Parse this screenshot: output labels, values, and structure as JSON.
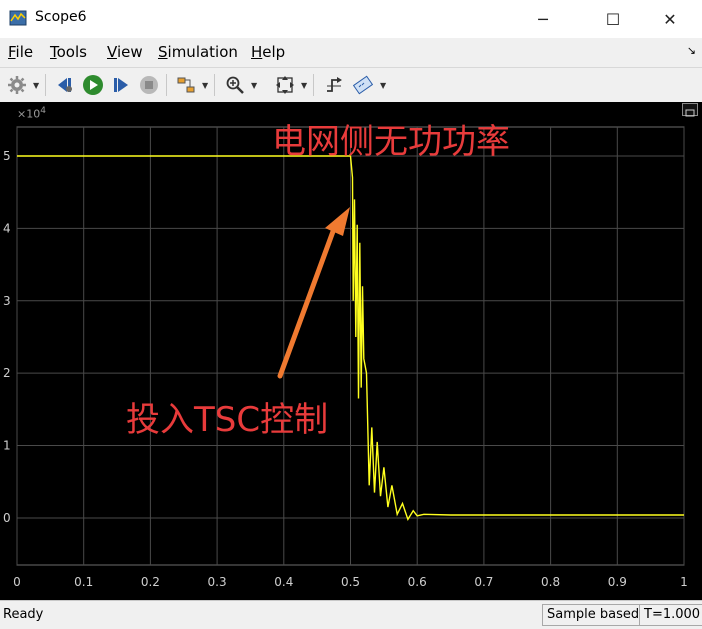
{
  "window": {
    "title": "Scope6",
    "minimize_glyph": "─",
    "maximize_glyph": "☐",
    "close_glyph": "✕"
  },
  "menu": {
    "items": [
      {
        "label": "File",
        "mnemonic": "F",
        "rest": "ile"
      },
      {
        "label": "Tools",
        "mnemonic": "T",
        "rest": "ools"
      },
      {
        "label": "View",
        "mnemonic": "V",
        "rest": "iew"
      },
      {
        "label": "Simulation",
        "mnemonic": "S",
        "rest": "imulation"
      },
      {
        "label": "Help",
        "mnemonic": "H",
        "rest": "elp"
      }
    ],
    "dock_glyph": "↘"
  },
  "toolbar": {
    "icons": [
      "settings-icon",
      "step-back-icon",
      "run-icon",
      "step-forward-icon",
      "stop-icon",
      "highlight-block-icon",
      "zoom-icon",
      "autoscale-icon",
      "triggers-icon",
      "cursor-measurements-icon"
    ]
  },
  "plot": {
    "exponent_label": "×10",
    "exponent_power": "4",
    "annotation_top": "电网侧无功功率",
    "annotation_bottom": "投入TSC控制",
    "annotation_color": "#e83b3b",
    "arrow_color": "#f07a30",
    "background": "#000000",
    "line_color": "#ffff1f"
  },
  "chart_data": {
    "type": "line",
    "title": "",
    "xlabel": "",
    "ylabel": "",
    "xlim": [
      0,
      1
    ],
    "ylim": [
      -0.65,
      5.4
    ],
    "y_scale_exponent": 4,
    "x_ticks": [
      "0",
      "0.1",
      "0.2",
      "0.3",
      "0.4",
      "0.5",
      "0.6",
      "0.7",
      "0.8",
      "0.9",
      "1"
    ],
    "y_ticks": [
      "0",
      "1",
      "2",
      "3",
      "4",
      "5"
    ],
    "grid": true,
    "series": [
      {
        "x": [
          0,
          0.1,
          0.2,
          0.3,
          0.4,
          0.5,
          0.503,
          0.504,
          0.506,
          0.508,
          0.51,
          0.512,
          0.514,
          0.516,
          0.518,
          0.52,
          0.524,
          0.528,
          0.532,
          0.536,
          0.54,
          0.545,
          0.55,
          0.556,
          0.562,
          0.57,
          0.578,
          0.586,
          0.594,
          0.6,
          0.61,
          0.65,
          0.7,
          0.75,
          0.8,
          0.85,
          0.9,
          0.95,
          1.0
        ],
        "y": [
          5.0,
          5.0,
          5.0,
          5.0,
          5.0,
          5.0,
          4.7,
          3.0,
          4.4,
          2.5,
          4.05,
          1.65,
          3.8,
          1.8,
          3.2,
          2.2,
          2.0,
          0.45,
          1.25,
          0.35,
          1.05,
          0.3,
          0.7,
          0.15,
          0.45,
          0.05,
          0.2,
          -0.02,
          0.1,
          0.03,
          0.05,
          0.04,
          0.04,
          0.04,
          0.04,
          0.04,
          0.04,
          0.04,
          0.04
        ]
      }
    ]
  },
  "status": {
    "ready": "Ready",
    "sample_mode": "Sample based",
    "time": "T=1.000"
  }
}
